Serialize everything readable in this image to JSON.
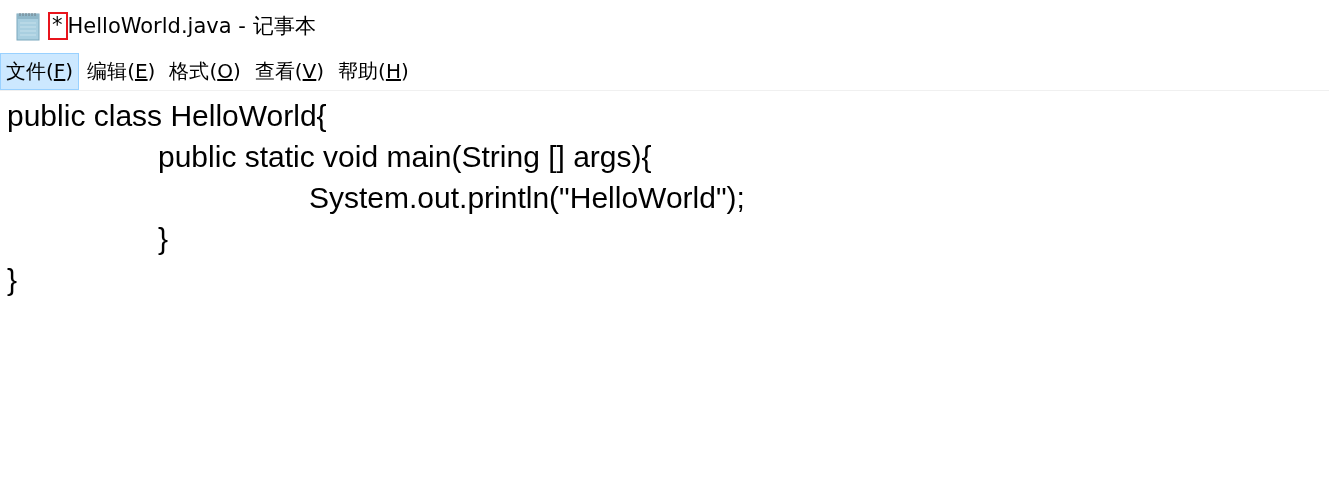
{
  "window": {
    "title_mark": "*",
    "title_mark_highlighted": true,
    "title": "HelloWorld.java - 记事本"
  },
  "menu": [
    {
      "before": "文件(",
      "key": "F",
      "after": ")",
      "selected": true
    },
    {
      "before": "编辑(",
      "key": "E",
      "after": ")",
      "selected": false
    },
    {
      "before": "格式(",
      "key": "O",
      "after": ")",
      "selected": false
    },
    {
      "before": "查看(",
      "key": "V",
      "after": ")",
      "selected": false
    },
    {
      "before": "帮助(",
      "key": "H",
      "after": ")",
      "selected": false
    }
  ],
  "editor": {
    "lines": [
      "public class HelloWorld{",
      "\tpublic static void main(String [] args){",
      "\t\tSystem.out.println(\"HelloWorld\");",
      "\t}",
      "}"
    ]
  }
}
